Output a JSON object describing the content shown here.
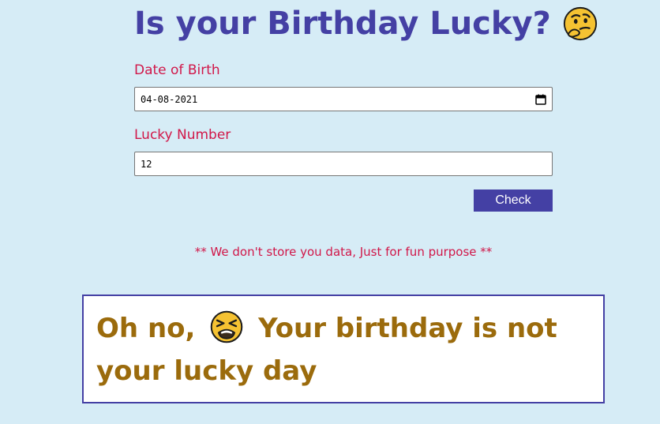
{
  "title": "Is your Birthday Lucky?",
  "title_emoji": "thinking-face-emoji",
  "dob": {
    "label": "Date of Birth",
    "value": "04-08-2021",
    "icon": "calendar-icon"
  },
  "lucky": {
    "label": "Lucky Number",
    "value": "12"
  },
  "check_label": "Check",
  "note": "** We don't store you data, Just for fun purpose **",
  "result": {
    "prefix": "Oh no,",
    "emoji": "tired-face-emoji",
    "message": "Your birthday is not your lucky day"
  },
  "colors": {
    "background": "#d6ecf6",
    "title": "#4440a4",
    "label": "#d11749",
    "button": "#4440a4",
    "result_text": "#9b6b0c",
    "result_border": "#4440a4"
  }
}
